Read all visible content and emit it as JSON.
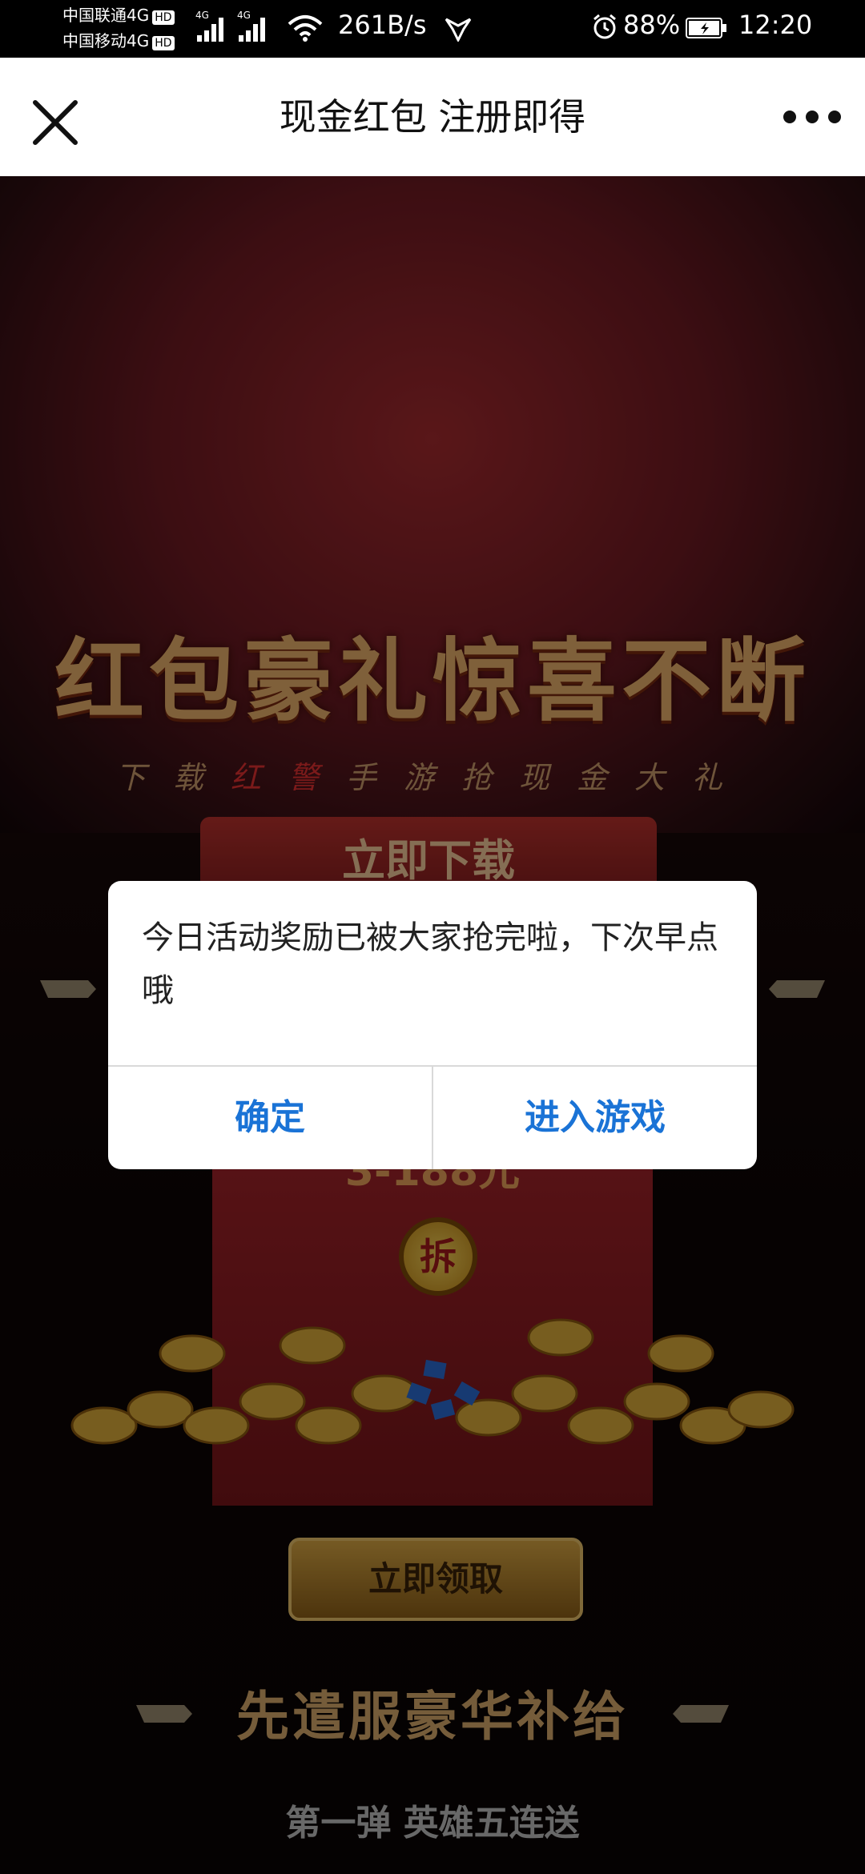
{
  "status_bar": {
    "carrier1": "中国联通4G",
    "carrier2": "中国移动4G",
    "hd": "HD",
    "net1": "4G",
    "net2": "4G",
    "speed": "261B/s",
    "battery": "88%",
    "time": "12:20"
  },
  "nav": {
    "title": "现金红包 注册即得"
  },
  "banner": {
    "headline": "红包豪礼惊喜不断",
    "sub_before": "下载",
    "sub_highlight": "红警",
    "sub_after": "手游抢现金大礼",
    "download_label": "立即下载"
  },
  "envelope": {
    "amount": "3-188元",
    "open_label": "拆"
  },
  "claim_label": "立即领取",
  "section": {
    "title": "先遣服豪华补给",
    "subtitle": "第一弹 英雄五连送"
  },
  "dialog": {
    "message": "今日活动奖励已被大家抢完啦，下次早点哦",
    "confirm": "确定",
    "enter_game": "进入游戏"
  },
  "colors": {
    "dialog_button": "#1a73d6",
    "nav_bg": "#ffffff"
  }
}
